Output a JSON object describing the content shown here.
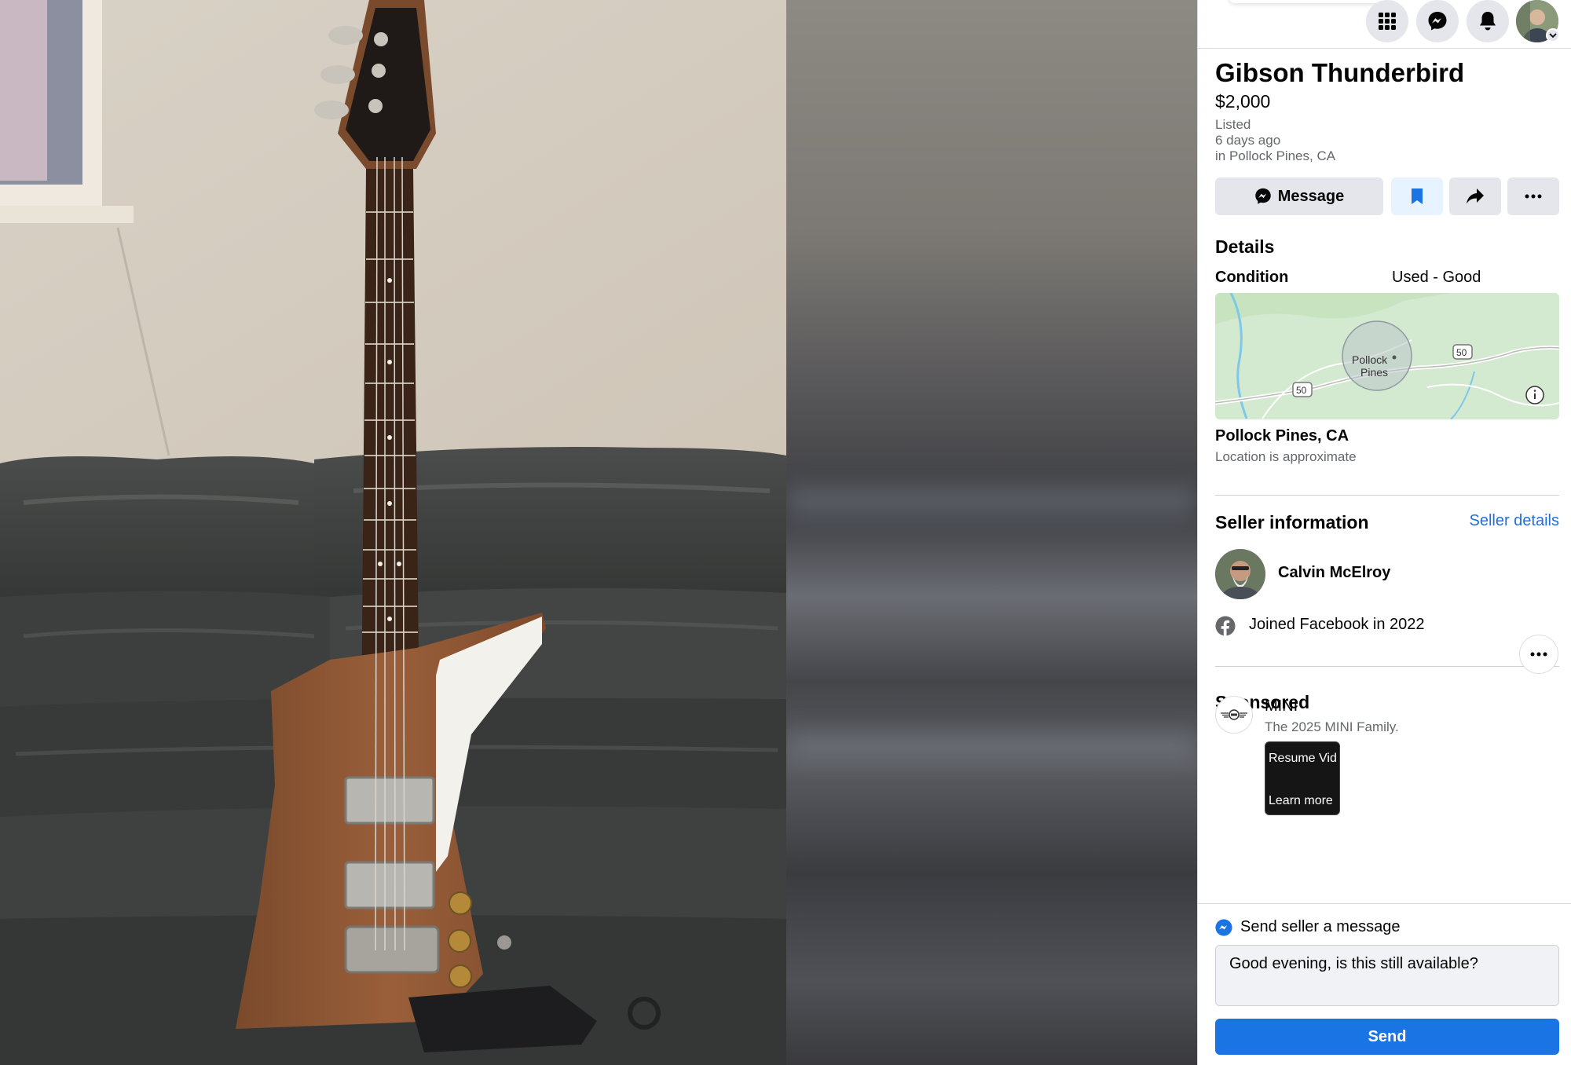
{
  "topbar": {
    "icons": [
      "menu-grid-icon",
      "messenger-icon",
      "notifications-icon",
      "profile-avatar"
    ]
  },
  "listing": {
    "title": "Gibson Thunderbird",
    "price": "$2,000",
    "listed_label": "Listed",
    "listed_time": "6 days ago",
    "listed_location": "in Pollock Pines, CA"
  },
  "actions": {
    "message_label": "Message",
    "save_icon": "bookmark-icon",
    "share_icon": "share-icon",
    "more_icon": "more-icon"
  },
  "details": {
    "heading": "Details",
    "condition_label": "Condition",
    "condition_value": "Used - Good"
  },
  "map": {
    "place_label_line1": "Pollock",
    "place_label_line2": "Pines",
    "route_shield_1": "50",
    "route_shield_2": "50",
    "info_icon": "info-icon"
  },
  "location": {
    "title": "Pollock Pines, CA",
    "subtitle": "Location is approximate"
  },
  "seller": {
    "heading": "Seller information",
    "details_link": "Seller details",
    "name": "Calvin McElroy",
    "joined": "Joined Facebook in 2022"
  },
  "sponsored": {
    "heading": "Sponsored",
    "advertiser": "MINI",
    "tagline": "The 2025 MINI Family.",
    "thumb_top_text": "Resume Vid",
    "thumb_bottom_text": "Learn more"
  },
  "message_box": {
    "heading": "Send seller a message",
    "value": "Good evening, is this still available?",
    "send_label": "Send"
  },
  "colors": {
    "accent": "#1b74e4",
    "link": "#216fdb",
    "secondary_text": "#65676b",
    "button_gray": "#e4e6eb"
  }
}
